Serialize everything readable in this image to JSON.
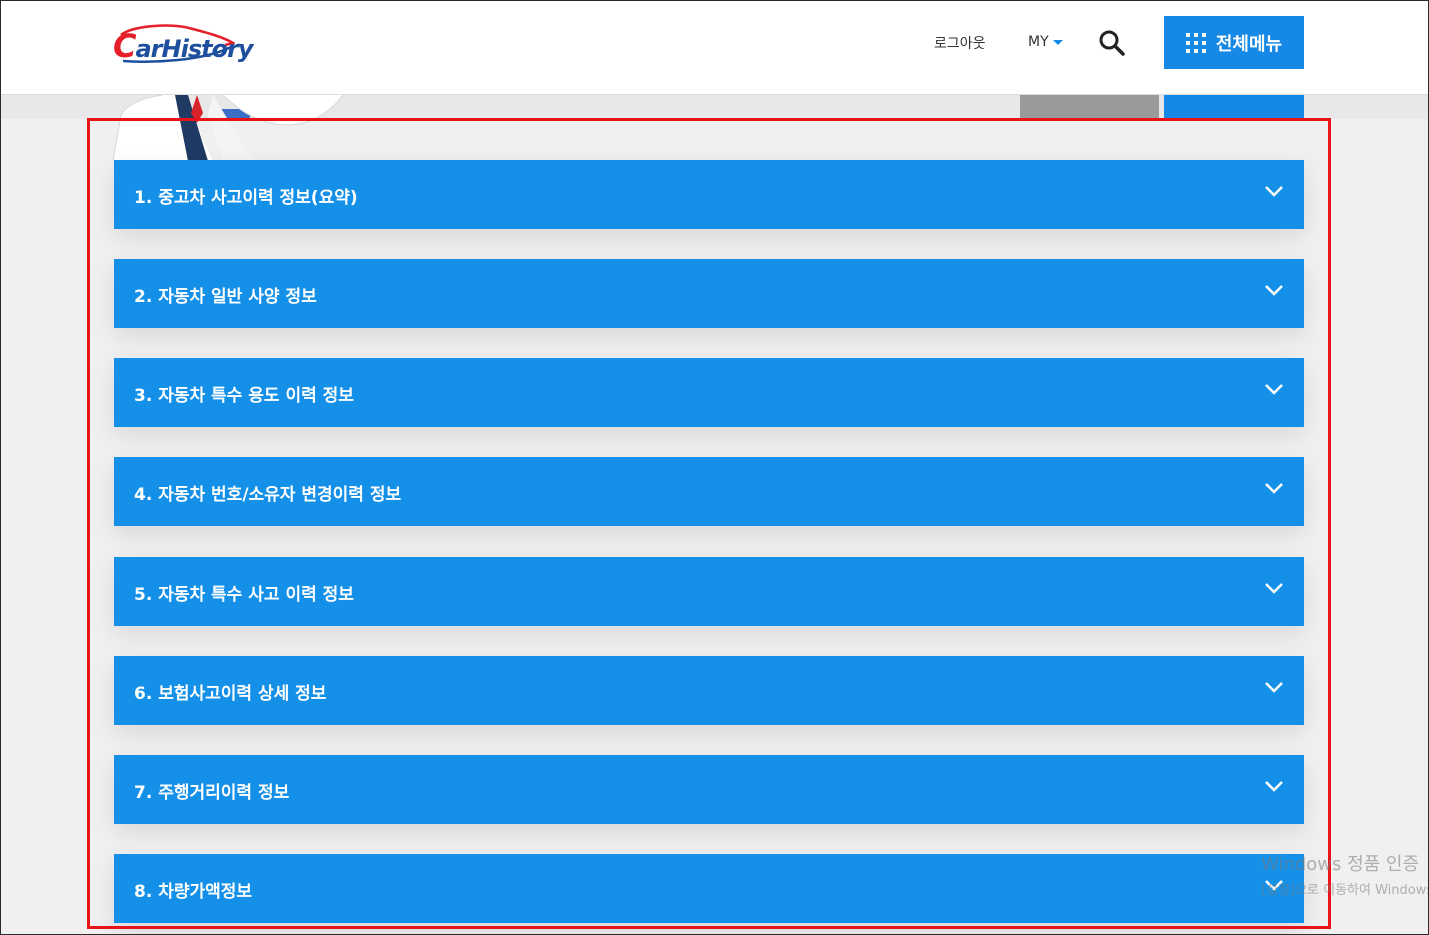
{
  "header": {
    "logo_text_first": "C",
    "logo_text_rest": "arHistory",
    "logout_label": "로그아웃",
    "my_label": "MY",
    "all_menu_label": "전체메뉴",
    "brand_color": "#1589e5",
    "logo_red": "#e5202a",
    "logo_blue": "#1d4f9e"
  },
  "icons": {
    "search": "search-icon",
    "all_menu": "grid-icon",
    "caret": "caret-down-icon",
    "chevron": "chevron-down-icon"
  },
  "accordion": {
    "items": [
      {
        "label": "1. 중고차 사고이력 정보(요약)"
      },
      {
        "label": "2. 자동차 일반 사양 정보"
      },
      {
        "label": "3. 자동차 특수 용도 이력 정보"
      },
      {
        "label": "4. 자동차 번호/소유자 변경이력 정보"
      },
      {
        "label": "5. 자동차 특수 사고 이력 정보"
      },
      {
        "label": "6. 보험사고이력 상세 정보"
      },
      {
        "label": "7. 주행거리이력 정보"
      },
      {
        "label": "8. 차량가액정보"
      }
    ],
    "item_color": "#1590e8"
  },
  "highlight_color": "#e8141a",
  "watermark": {
    "line1": "Windows 정품 인증",
    "line2": "[설정]으로 이동하여 Windows"
  }
}
